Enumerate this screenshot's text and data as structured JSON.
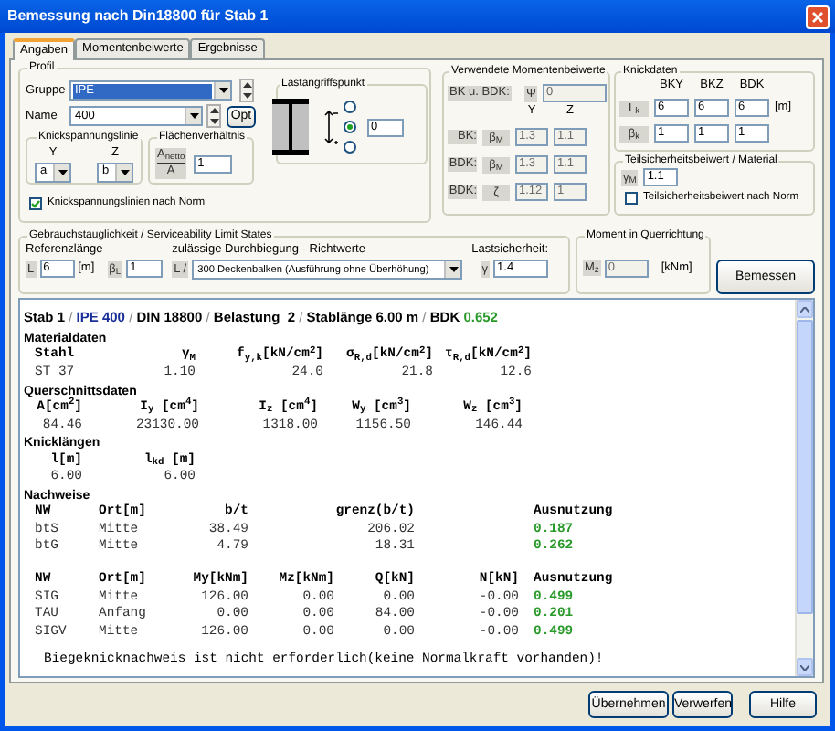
{
  "window": {
    "title": "Bemessung nach Din18800 für Stab 1"
  },
  "tabs": [
    {
      "label": "Angaben",
      "selected": true
    },
    {
      "label": "Momentenbeiwerte",
      "selected": false
    },
    {
      "label": "Ergebnisse",
      "selected": false
    }
  ],
  "profil": {
    "title": "Profil",
    "gruppe": {
      "label": "Gruppe",
      "value": "IPE",
      "focused": true
    },
    "name": {
      "label": "Name",
      "value": "400"
    },
    "opt_button": "Opt",
    "knickspannungslinie": {
      "title": "Knickspannungslinie",
      "columns": [
        {
          "label": "Y",
          "value": "a"
        },
        {
          "label": "Z",
          "value": "b"
        }
      ]
    },
    "flaechenverhaeltnis": {
      "title": "Flächenverhältnis",
      "numerator": "A$_{netto}$",
      "denominator": "A",
      "value": "1"
    },
    "norm_checkbox": {
      "label": "Knickspannungslinien nach Norm",
      "checked": true
    }
  },
  "lastangriffspunkt": {
    "title": "Lastangriffspunkt",
    "options": [
      {
        "selected": false
      },
      {
        "selected": true
      },
      {
        "selected": false
      }
    ],
    "value": "0"
  },
  "momentenbeiwerte": {
    "title": "Verwendete Momentenbeiwerte",
    "fields_disabled": true,
    "psi": {
      "label": "BK u. BDK:",
      "symbol": "Ψ",
      "value": "0"
    },
    "columns": [
      "Y",
      "Z"
    ],
    "rows": [
      {
        "label": "BK:",
        "symbol": "β$_{M}$",
        "values": [
          "1.3",
          "1.1"
        ]
      },
      {
        "label": "BDK:",
        "symbol": "β$_{M}$",
        "values": [
          "1.3",
          "1.1"
        ]
      },
      {
        "label": "BDK:",
        "symbol": "ζ",
        "values": [
          "1.12",
          "1"
        ]
      }
    ]
  },
  "knickdaten": {
    "title": "Knickdaten",
    "columns": [
      "BKY",
      "BKZ",
      "BDK"
    ],
    "rows": [
      {
        "symbol": "L$_{k}$",
        "values": [
          "6",
          "6",
          "6"
        ],
        "unit": "[m]"
      },
      {
        "symbol": "β$_{k}$",
        "values": [
          "1",
          "1",
          "1"
        ]
      }
    ]
  },
  "teilsicherheit": {
    "title": "Teilsicherheitsbeiwert / Material",
    "symbol": "γ$_{M}$",
    "value": "1.1",
    "checkbox": {
      "label": "Teilsicherheitsbeiwert nach Norm",
      "checked": false
    }
  },
  "gebrauch": {
    "title": "Gebrauchstauglichkeit / Serviceability Limit States",
    "referenz": {
      "label": "Referenzlänge",
      "symbol": "L",
      "value": "6",
      "unit": "[m]",
      "beta_symbol": "β$_{L}$",
      "beta_value": "1"
    },
    "durchbiegung": {
      "label": "zulässige Durchbiegung - Richtwerte",
      "symbol": "L /",
      "value": "300 Deckenbalken (Ausführung ohne Überhöhung)"
    },
    "lastsicherheit": {
      "label": "Lastsicherheit:",
      "symbol": "γ",
      "value": "1.4"
    }
  },
  "moment": {
    "title": "Moment in Querrichtung",
    "symbol": "M$_{z}$",
    "value": "0",
    "unit": "[kNm]",
    "disabled": true
  },
  "bemessen_button": "Bemessen",
  "results": {
    "header": [
      {
        "text": "Stab 1",
        "kind": "label"
      },
      {
        "text": "/",
        "kind": "separator"
      },
      {
        "text": "IPE 400",
        "kind": "profile"
      },
      {
        "text": "/",
        "kind": "separator"
      },
      {
        "text": "DIN 18800",
        "kind": "label"
      },
      {
        "text": "/",
        "kind": "separator"
      },
      {
        "text": "Belastung_2",
        "kind": "label"
      },
      {
        "text": "/",
        "kind": "separator"
      },
      {
        "text": "Stablänge 6.00 m",
        "kind": "label"
      },
      {
        "text": "/",
        "kind": "separator"
      },
      {
        "text": "BDK",
        "kind": "label"
      },
      {
        "text": "0.652",
        "kind": "ratio"
      }
    ],
    "blocks": [
      {
        "kind": "heading",
        "text": "Materialdaten"
      },
      {
        "kind": "table",
        "columns": [
          {
            "label": "Stahl",
            "kind": "text"
          },
          {
            "label": "γ$_{M}$",
            "kind": "number"
          },
          {
            "label": "f$_{y,k}$[kN/cm$^{2}$]",
            "kind": "number"
          },
          {
            "label": "σ$_{R,d}$[kN/cm$^{2}$]",
            "kind": "number"
          },
          {
            "label": "τ$_{R,d}$[kN/cm$^{2}$]",
            "kind": "number"
          }
        ],
        "rows": [
          [
            "ST 37",
            "1.10",
            "24.0",
            "21.8",
            "12.6"
          ]
        ]
      },
      {
        "kind": "heading",
        "text": "Querschnittsdaten"
      },
      {
        "kind": "table",
        "columns": [
          {
            "label": "A[cm$^{2}$]",
            "kind": "number"
          },
          {
            "label": "I$_{y}$ [cm$^{4}$]",
            "kind": "number"
          },
          {
            "label": "I$_{z}$ [cm$^{4}$]",
            "kind": "number"
          },
          {
            "label": "W$_{y}$ [cm$^{3}$]",
            "kind": "number"
          },
          {
            "label": "W$_{z}$ [cm$^{3}$]",
            "kind": "number"
          }
        ],
        "rows": [
          [
            "84.46",
            "23130.00",
            "1318.00",
            "1156.50",
            "146.44"
          ]
        ]
      },
      {
        "kind": "heading",
        "text": "Knicklängen"
      },
      {
        "kind": "table",
        "columns": [
          {
            "label": "l[m]",
            "kind": "number"
          },
          {
            "label": "l$_{kd}$ [m]",
            "kind": "number"
          }
        ],
        "rows": [
          [
            "6.00",
            "6.00"
          ]
        ]
      },
      {
        "kind": "heading",
        "text": "Nachweise"
      },
      {
        "kind": "table",
        "columns": [
          {
            "label": "NW",
            "kind": "text"
          },
          {
            "label": "Ort[m]",
            "kind": "text"
          },
          {
            "label": "b/t",
            "kind": "number"
          },
          {
            "label": "grenz(b/t)",
            "kind": "number"
          },
          {
            "label": "Ausnutzung",
            "kind": "ratio"
          }
        ],
        "rows": [
          [
            "btS",
            "Mitte",
            "38.49",
            "206.02",
            "0.187"
          ],
          [
            "btG",
            "Mitte",
            "4.79",
            "18.31",
            "0.262"
          ]
        ]
      },
      {
        "kind": "table",
        "columns": [
          {
            "label": "NW",
            "kind": "text"
          },
          {
            "label": "Ort[m]",
            "kind": "text"
          },
          {
            "label": "My[kNm]",
            "kind": "number"
          },
          {
            "label": "Mz[kNm]",
            "kind": "number"
          },
          {
            "label": "Q[kN]",
            "kind": "number"
          },
          {
            "label": "N[kN]",
            "kind": "number"
          },
          {
            "label": "Ausnutzung",
            "kind": "ratio"
          }
        ],
        "rows": [
          [
            "SIG",
            "Mitte",
            "126.00",
            "0.00",
            "0.00",
            "-0.00",
            "0.499"
          ],
          [
            "TAU",
            "Anfang",
            "0.00",
            "0.00",
            "84.00",
            "-0.00",
            "0.201"
          ],
          [
            "SIGV",
            "Mitte",
            "126.00",
            "0.00",
            "0.00",
            "-0.00",
            "0.499"
          ]
        ]
      },
      {
        "kind": "note",
        "text": "Biegeknicknachweis ist nicht erforderlich(keine Normalkraft vorhanden)!"
      }
    ]
  },
  "buttons": [
    "Übernehmen",
    "Verwerfen",
    "Hilfe"
  ]
}
